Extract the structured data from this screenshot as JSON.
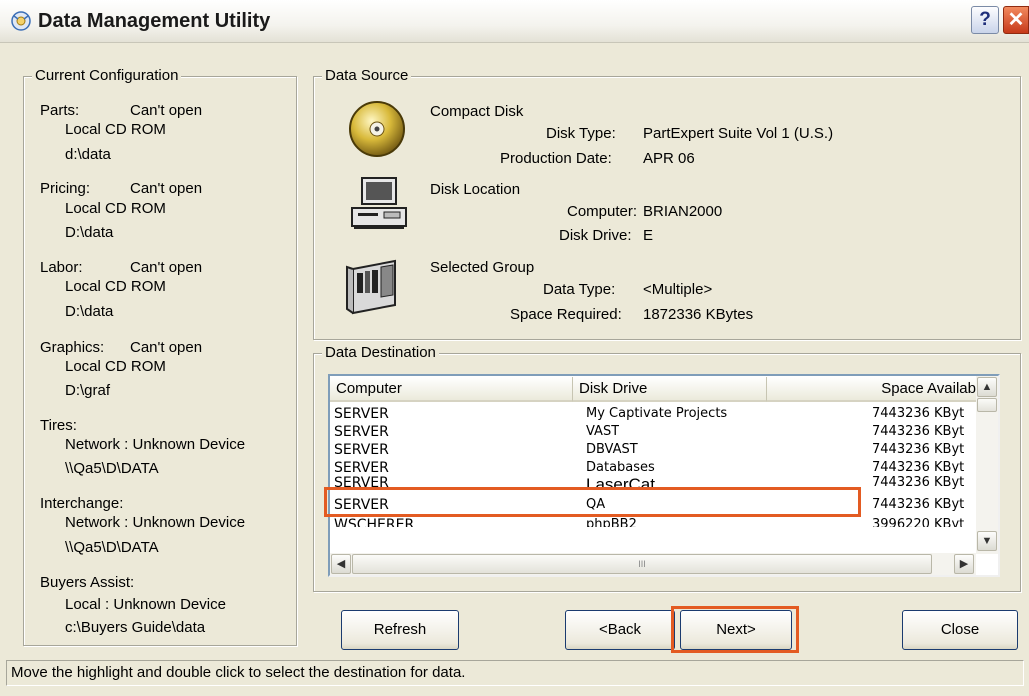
{
  "window": {
    "title": "Data Management Utility",
    "help_glyph": "?",
    "close_glyph": "✕"
  },
  "config": {
    "legend": "Current Configuration",
    "items": [
      {
        "name": "Parts:",
        "status": "Can't open",
        "type": "Local CD ROM",
        "path": "d:\\data"
      },
      {
        "name": "Pricing:",
        "status": "Can't open",
        "type": "Local CD ROM",
        "path": "D:\\data"
      },
      {
        "name": "Labor:",
        "status": "Can't open",
        "type": "Local CD ROM",
        "path": "D:\\data"
      },
      {
        "name": "Graphics:",
        "status": "Can't open",
        "type": "Local CD ROM",
        "path": "D:\\graf"
      },
      {
        "name": "Tires:",
        "type": "Network : Unknown Device",
        "path": "\\\\Qa5\\D\\DATA"
      },
      {
        "name": "Interchange:",
        "type": "Network : Unknown Device",
        "path": "\\\\Qa5\\D\\DATA"
      },
      {
        "name": "Buyers Assist:",
        "type": "Local : Unknown Device",
        "path": "c:\\Buyers Guide\\data"
      }
    ]
  },
  "source": {
    "legend": "Data Source",
    "compact_disk": {
      "title": "Compact Disk",
      "disk_type_label": "Disk Type:",
      "disk_type": "PartExpert Suite Vol 1 (U.S.)",
      "prod_date_label": "Production Date:",
      "prod_date": "APR 06"
    },
    "disk_location": {
      "title": "Disk Location",
      "computer_label": "Computer:",
      "computer": "BRIAN2000",
      "drive_label": "Disk Drive:",
      "drive": "E"
    },
    "selected_group": {
      "title": "Selected Group",
      "data_type_label": "Data Type:",
      "data_type": "<Multiple>",
      "space_label": "Space Required:",
      "space": "1872336 KBytes"
    }
  },
  "destination": {
    "legend": "Data Destination",
    "columns": [
      "Computer",
      "Disk Drive",
      "Space Availab"
    ],
    "rows": [
      {
        "computer": "SERVER",
        "drive": "My Captivate Projects",
        "space": "7443236 KByt"
      },
      {
        "computer": "SERVER",
        "drive": "VAST",
        "space": "7443236 KByt"
      },
      {
        "computer": "SERVER",
        "drive": "DBVAST",
        "space": "7443236 KByt"
      },
      {
        "computer": "SERVER",
        "drive": "Databases",
        "space": "7443236 KByt"
      },
      {
        "computer": "SERVER",
        "drive": "LaserCat",
        "space": "7443236 KByt"
      },
      {
        "computer": "SERVER",
        "drive": "QA",
        "space": "7443236 KByt"
      },
      {
        "computer": "WSCHERER",
        "drive": "phpBB2",
        "space": "3996220 KByt"
      }
    ],
    "hscroll_grip": "III"
  },
  "buttons": {
    "refresh": "Refresh",
    "back": "<Back",
    "next": "Next>",
    "close": "Close"
  },
  "status_text": "Move the highlight and double click to select the destination for data.",
  "colors": {
    "highlight": "#e35b22",
    "dialog_bg": "#ece9d8"
  }
}
